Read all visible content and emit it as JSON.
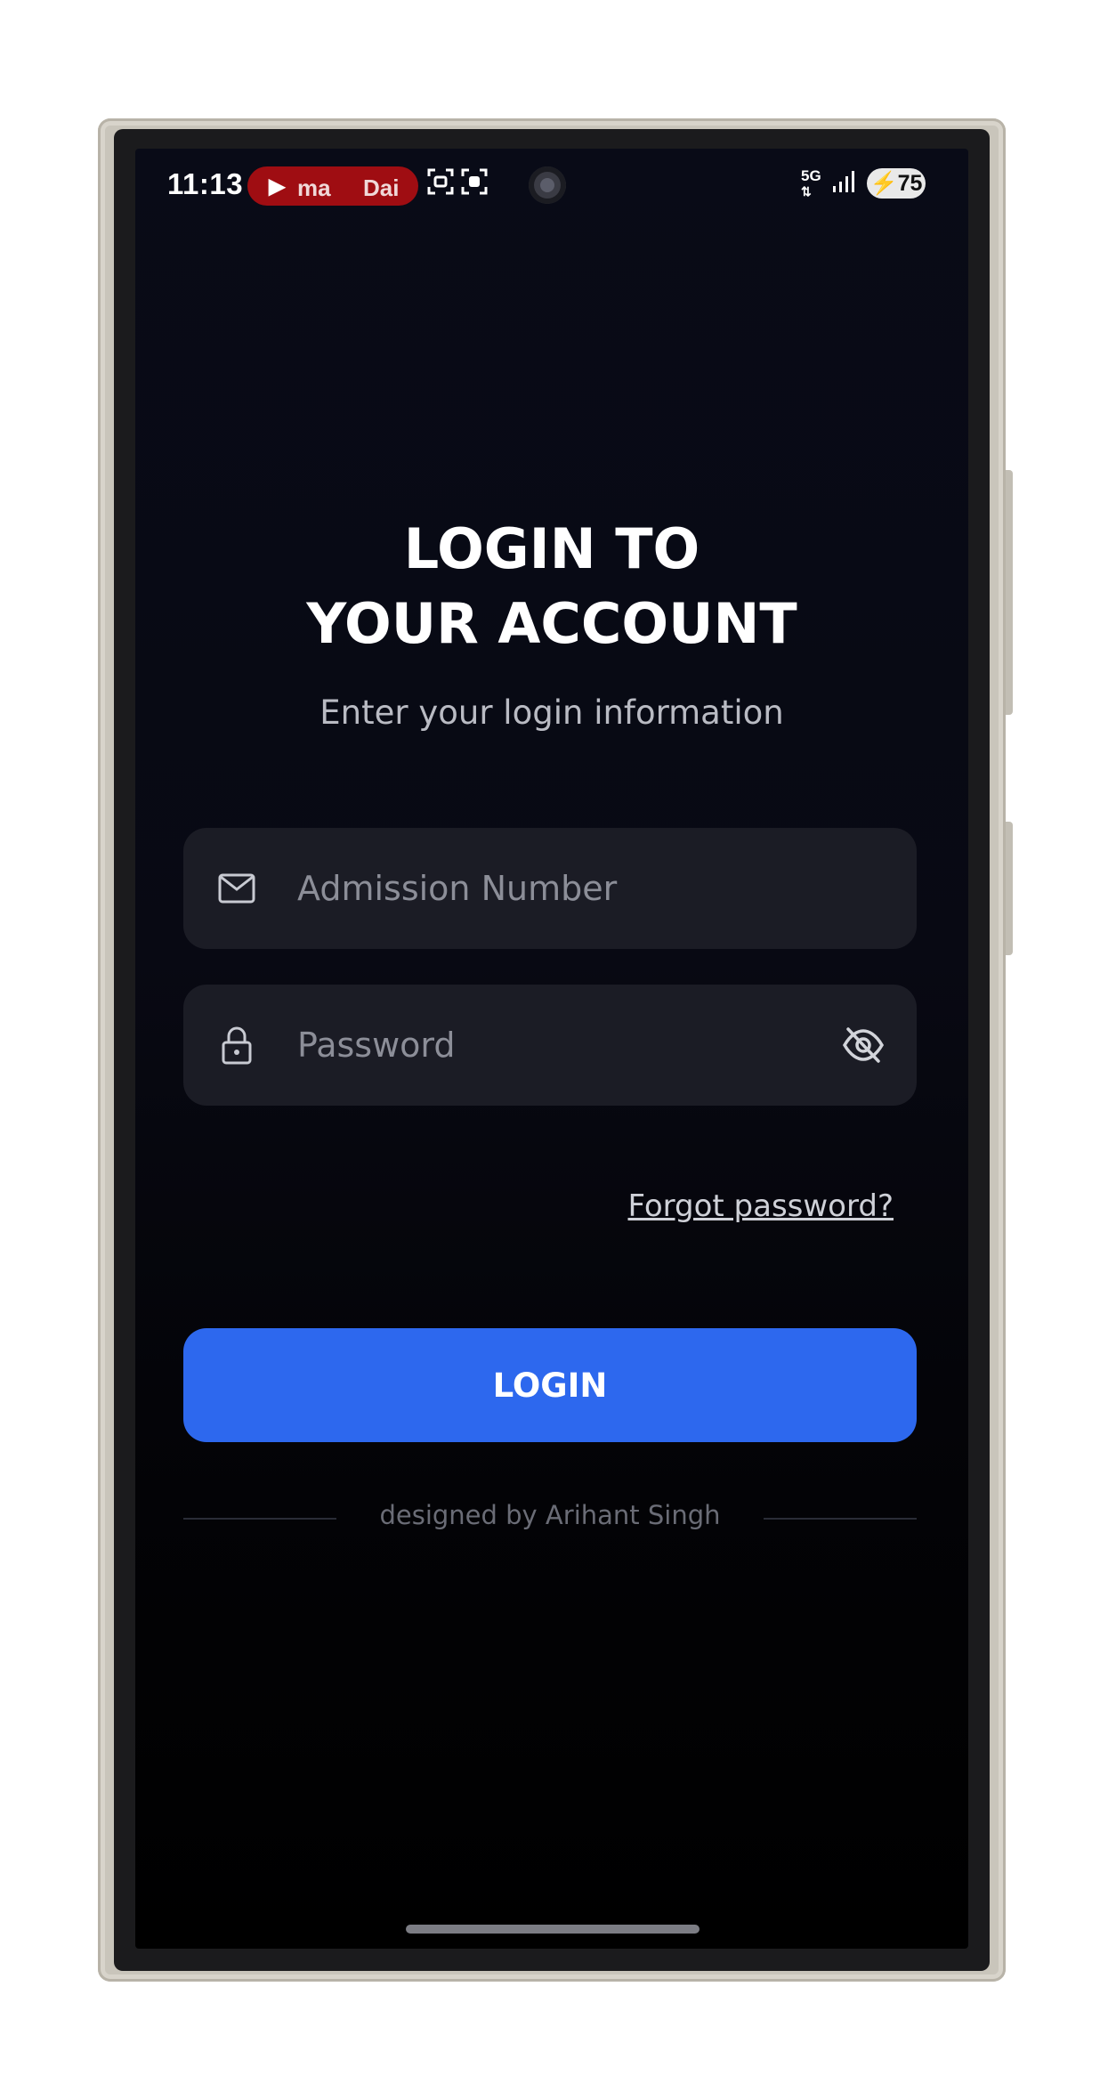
{
  "status_bar": {
    "time": "11:13",
    "media_text_1": "ma",
    "media_text_2": "Dai",
    "network": "5G",
    "battery": "75"
  },
  "login": {
    "title_line1": "LOGIN TO",
    "title_line2": "YOUR ACCOUNT",
    "subtitle": "Enter your login information",
    "admission_placeholder": "Admission Number",
    "password_placeholder": "Password",
    "forgot_label": "Forgot password?",
    "login_label": "LOGIN",
    "footer": "designed by Arihant Singh"
  },
  "colors": {
    "background": "#090b17",
    "field": "#1b1c25",
    "accent": "#2d68ee",
    "media_pill": "#9f0d12"
  },
  "icons": {
    "admission": "mail-icon",
    "password": "lock-icon",
    "toggle": "eye-off-icon"
  }
}
